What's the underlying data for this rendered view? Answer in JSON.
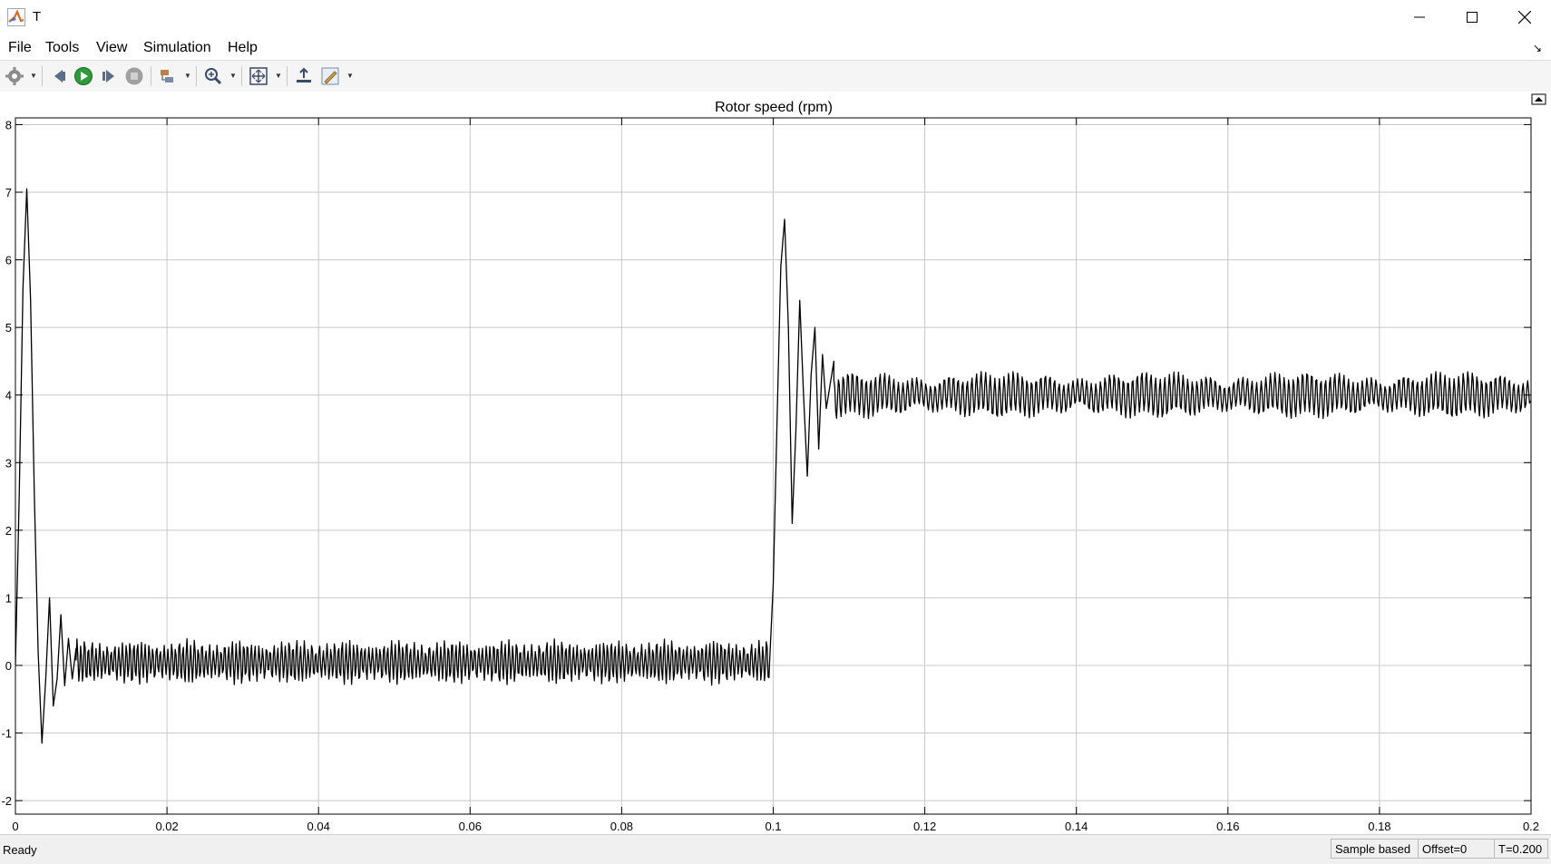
{
  "window": {
    "title": "T"
  },
  "menu": {
    "items": [
      "File",
      "Tools",
      "View",
      "Simulation",
      "Help"
    ]
  },
  "toolbar": {
    "buttons": [
      "settings-icon",
      "step-back-icon",
      "run-icon",
      "step-forward-icon",
      "stop-icon",
      "signal-select-icon",
      "zoom-icon",
      "fit-to-view-icon",
      "write-highlight-icon",
      "style-icon"
    ]
  },
  "chart_data": {
    "type": "line",
    "title": "Rotor speed (rpm)",
    "xlabel": "",
    "ylabel": "",
    "xlim": [
      0,
      0.2
    ],
    "ylim": [
      -2.2,
      8.1
    ],
    "x_ticks": [
      "0",
      "0.02",
      "0.04",
      "0.06",
      "0.08",
      "0.1",
      "0.12",
      "0.14",
      "0.16",
      "0.18",
      "0.2"
    ],
    "y_ticks": [
      "-2",
      "-1",
      "0",
      "1",
      "2",
      "3",
      "4",
      "5",
      "6",
      "7",
      "8"
    ],
    "grid": true,
    "line_color": "#000000",
    "series": [
      {
        "x": [
          0,
          0.0005,
          0.001,
          0.0015,
          0.002,
          0.0025,
          0.003,
          0.0035,
          0.004,
          0.0045,
          0.005,
          0.0055,
          0.006,
          0.0065,
          0.007,
          0.0075,
          0.008,
          0.01,
          0.02,
          0.04,
          0.06,
          0.08,
          0.0995,
          0.1,
          0.1005,
          0.101,
          0.1015,
          0.102,
          0.1025,
          0.103,
          0.1035,
          0.104,
          0.1045,
          0.105,
          0.1055,
          0.106,
          0.1065,
          0.107,
          0.108,
          0.11,
          0.12,
          0.14,
          0.16,
          0.18,
          0.2
        ],
        "y": [
          0,
          2.5,
          5.6,
          7.05,
          5.4,
          2.5,
          0.2,
          -1.15,
          -0.2,
          1.0,
          -0.6,
          -0.2,
          0.75,
          -0.3,
          0.4,
          -0.2,
          0.25,
          0.05,
          0.05,
          0.05,
          0.05,
          0.05,
          0.0,
          1.2,
          3.6,
          5.9,
          6.6,
          5.0,
          2.1,
          3.5,
          5.4,
          4.0,
          2.8,
          4.3,
          5.0,
          3.2,
          4.6,
          3.8,
          4.5,
          4.0,
          4.0,
          4.0,
          4.0,
          4.0,
          4.0
        ]
      }
    ],
    "oscillation": {
      "before_step": {
        "mean": 0.05,
        "amplitude": 0.3
      },
      "after_step": {
        "mean": 4.0,
        "amplitude": 0.3
      }
    }
  },
  "status": {
    "ready": "Ready",
    "mode": "Sample based",
    "offset": "Offset=0",
    "time": "T=0.200"
  }
}
